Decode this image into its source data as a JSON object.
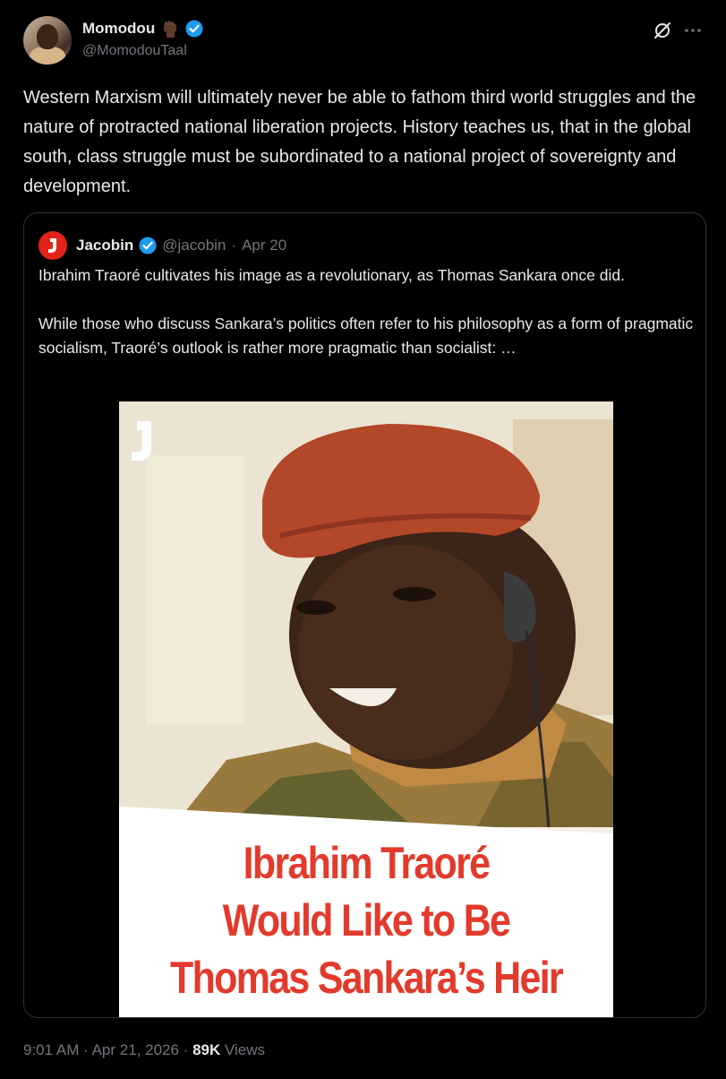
{
  "author": {
    "display_name": "Momodou",
    "handle": "@MomodouTaal"
  },
  "tweet": {
    "text": "Western Marxism will ultimately never be able to fathom third world struggles and the nature of protracted national liberation projects. History teaches us, that in the global south, class struggle must be subordinated to a national project of sovereignty and development."
  },
  "quote": {
    "name": "Jacobin",
    "handle": "@jacobin",
    "separator": "·",
    "date": "Apr 20",
    "paragraph1": "Ibrahim Traoré cultivates his image as a revolutionary, as Thomas Sankara once did.",
    "paragraph2": "While those who discuss Sankara’s politics often refer to his philosophy as a form of pragmatic socialism, Traoré’s outlook is rather more pragmatic than socialist: …",
    "image": {
      "headline_lines": [
        "Ibrahim Traoré",
        "Would Like to Be",
        "Thomas Sankara’s Heir"
      ]
    }
  },
  "meta": {
    "time": "9:01 AM",
    "sep1": "·",
    "date": "Apr 21, 2026",
    "sep2": "·",
    "views_count": "89K",
    "views_label": "Views"
  },
  "icons": {
    "fist": "raised-fist-emoji",
    "verified": "verified-badge",
    "grok": "grok-icon",
    "more": "more-icon"
  },
  "colors": {
    "background": "#000000",
    "text": "#e7e9ea",
    "secondary": "#71767b",
    "verified": "#1d9bf0",
    "jacobin_red": "#e2231a",
    "headline_red": "#e23a2c"
  }
}
